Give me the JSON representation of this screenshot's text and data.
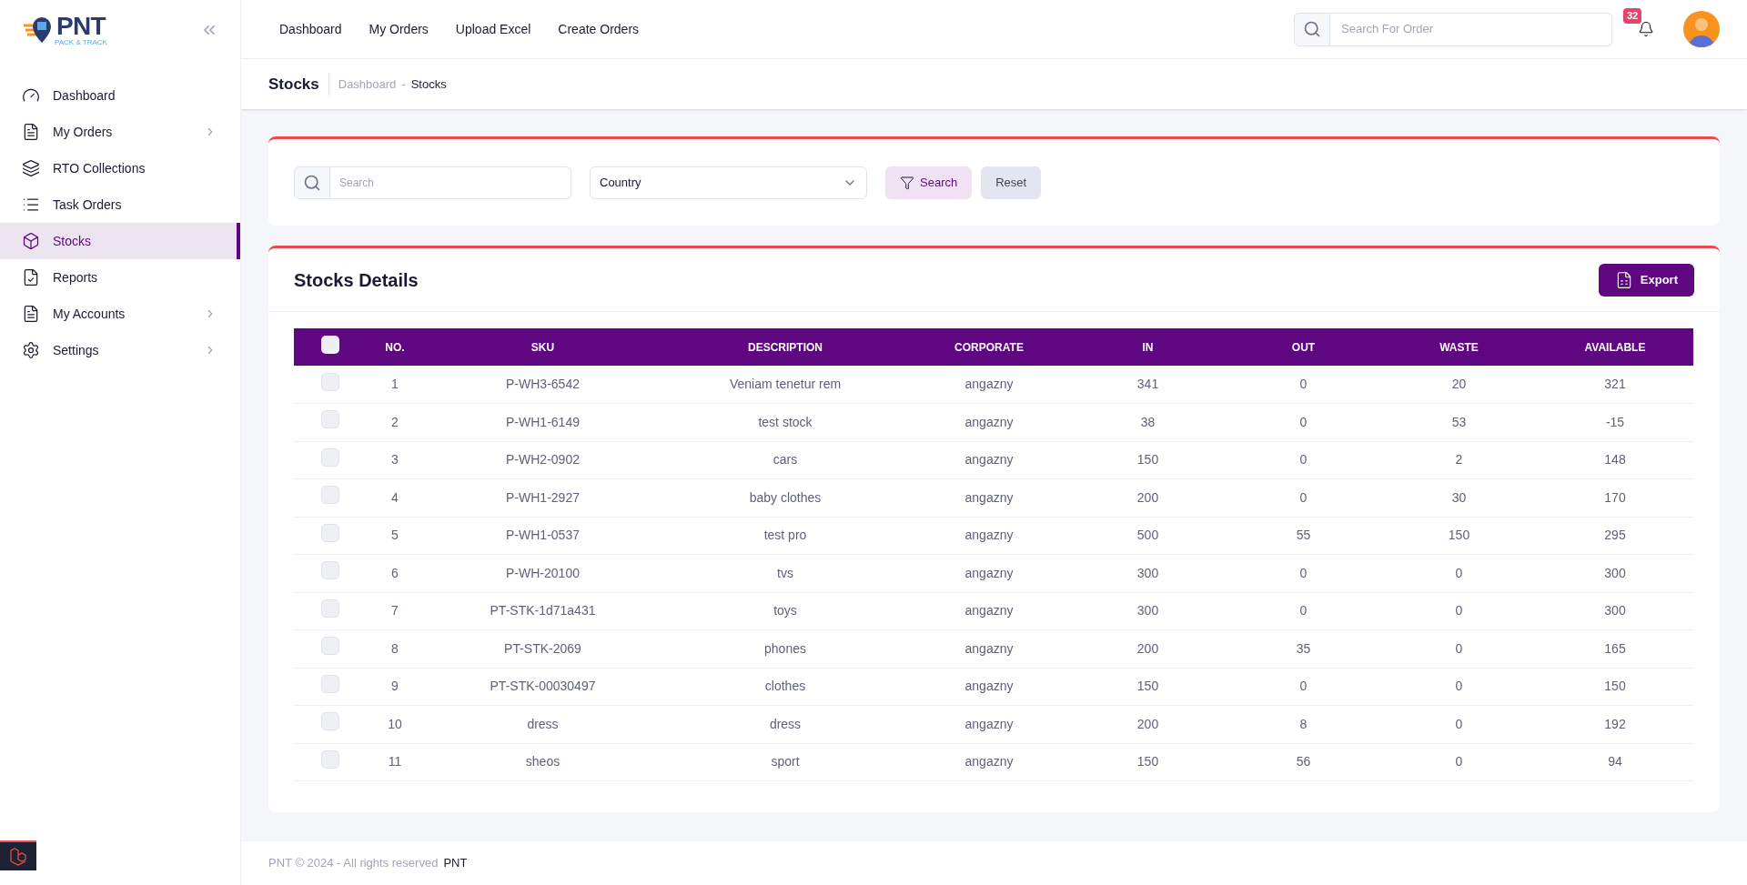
{
  "logo": {
    "name": "PNT",
    "tagline": "PACK & TRACK"
  },
  "sidebar": {
    "items": [
      {
        "label": "Dashboard",
        "selected": false,
        "has_submenu": false
      },
      {
        "label": "My Orders",
        "selected": false,
        "has_submenu": true
      },
      {
        "label": "RTO Collections",
        "selected": false,
        "has_submenu": false
      },
      {
        "label": "Task Orders",
        "selected": false,
        "has_submenu": false
      },
      {
        "label": "Stocks",
        "selected": true,
        "has_submenu": false
      },
      {
        "label": "Reports",
        "selected": false,
        "has_submenu": false
      },
      {
        "label": "My Accounts",
        "selected": false,
        "has_submenu": true
      },
      {
        "label": "Settings",
        "selected": false,
        "has_submenu": true
      }
    ]
  },
  "topnav": [
    "Dashboard",
    "My Orders",
    "Upload Excel",
    "Create Orders"
  ],
  "header_search": {
    "placeholder": "Search For Order"
  },
  "notifications": {
    "count": "32"
  },
  "page": {
    "title": "Stocks",
    "breadcrumb": [
      "Dashboard",
      "-",
      "Stocks"
    ]
  },
  "filters": {
    "search": {
      "placeholder": "Search"
    },
    "country": {
      "value": "Country"
    },
    "search_button": "Search",
    "reset_button": "Reset"
  },
  "table": {
    "title": "Stocks Details",
    "export_button": "Export",
    "all_checked": false,
    "columns": [
      "NO.",
      "SKU",
      "DESCRIPTION",
      "CORPORATE",
      "IN",
      "OUT",
      "WASTE",
      "AVAILABLE"
    ],
    "rows": [
      {
        "checked": false,
        "cells": [
          "1",
          "P-WH3-6542",
          "Veniam tenetur rem",
          "angazny",
          "341",
          "0",
          "20",
          "321"
        ]
      },
      {
        "checked": false,
        "cells": [
          "2",
          "P-WH1-6149",
          "test stock",
          "angazny",
          "38",
          "0",
          "53",
          "-15"
        ]
      },
      {
        "checked": false,
        "cells": [
          "3",
          "P-WH2-0902",
          "cars",
          "angazny",
          "150",
          "0",
          "2",
          "148"
        ]
      },
      {
        "checked": false,
        "cells": [
          "4",
          "P-WH1-2927",
          "baby clothes",
          "angazny",
          "200",
          "0",
          "30",
          "170"
        ]
      },
      {
        "checked": false,
        "cells": [
          "5",
          "P-WH1-0537",
          "test pro",
          "angazny",
          "500",
          "55",
          "150",
          "295"
        ]
      },
      {
        "checked": false,
        "cells": [
          "6",
          "P-WH-20100",
          "tvs",
          "angazny",
          "300",
          "0",
          "0",
          "300"
        ]
      },
      {
        "checked": false,
        "cells": [
          "7",
          "PT-STK-1d71a431",
          "toys",
          "angazny",
          "300",
          "0",
          "0",
          "300"
        ]
      },
      {
        "checked": false,
        "cells": [
          "8",
          "PT-STK-2069",
          "phones",
          "angazny",
          "200",
          "35",
          "0",
          "165"
        ]
      },
      {
        "checked": false,
        "cells": [
          "9",
          "PT-STK-00030497",
          "clothes",
          "angazny",
          "150",
          "0",
          "0",
          "150"
        ]
      },
      {
        "checked": false,
        "cells": [
          "10",
          "dress",
          "dress",
          "angazny",
          "200",
          "8",
          "0",
          "192"
        ]
      },
      {
        "checked": false,
        "cells": [
          "11",
          "sheos",
          "sport",
          "angazny",
          "150",
          "56",
          "0",
          "94"
        ]
      }
    ]
  },
  "footer": {
    "text": "PNT © 2024 - All rights reserved",
    "brand": "PNT"
  }
}
